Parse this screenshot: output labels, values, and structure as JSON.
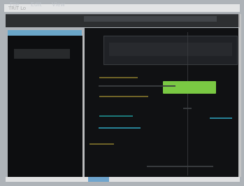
{
  "window": {
    "title": "TRiT Lo"
  },
  "menu": {
    "items": [
      "File",
      "Edit",
      "View"
    ]
  },
  "theme": {
    "background": "#aeb3b8",
    "panel": "#0d0e10",
    "accent_green": "#7ac943",
    "accent_blue": "#6aa6c8"
  }
}
